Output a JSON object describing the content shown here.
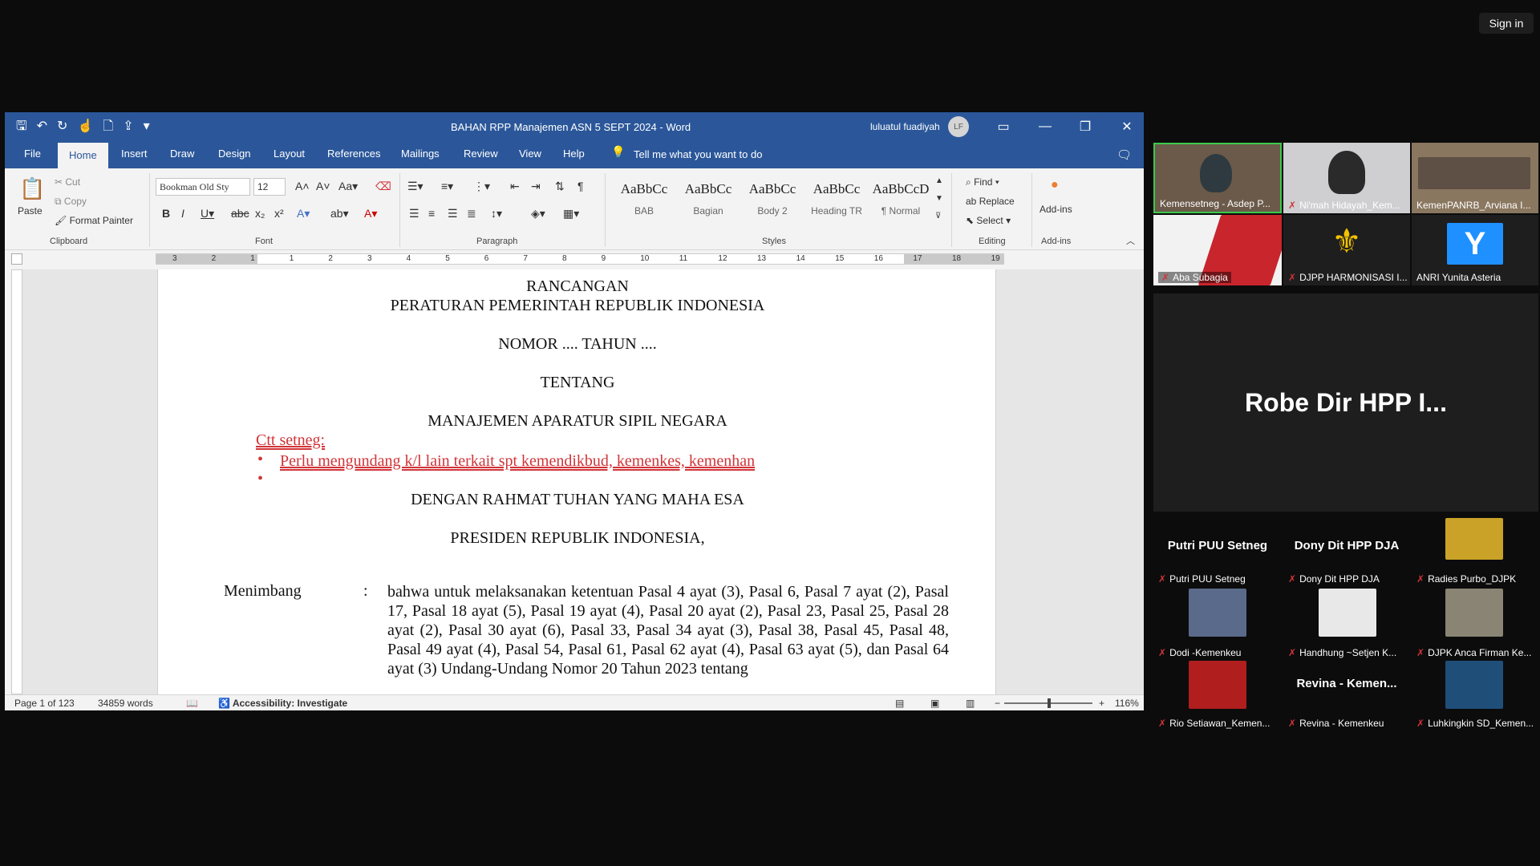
{
  "sign_in": "Sign in",
  "word": {
    "doc_title": "BAHAN RPP Manajemen ASN  5 SEPT 2024  -  Word",
    "user_name": "luluatul fuadiyah",
    "user_initials": "LF",
    "tabs": [
      "File",
      "Home",
      "Insert",
      "Draw",
      "Design",
      "Layout",
      "References",
      "Mailings",
      "Review",
      "View",
      "Help"
    ],
    "tell_me": "Tell me what you want to do",
    "clipboard": {
      "paste": "Paste",
      "cut": "Cut",
      "copy": "Copy",
      "format_painter": "Format Painter",
      "label": "Clipboard"
    },
    "font": {
      "name": "Bookman Old Sty",
      "size": "12",
      "label": "Font"
    },
    "paragraph_label": "Paragraph",
    "styles": [
      {
        "sample": "AaBbCc",
        "name": "BAB"
      },
      {
        "sample": "AaBbCc",
        "name": "Bagian"
      },
      {
        "sample": "AaBbCc",
        "name": "Body 2"
      },
      {
        "sample": "AaBbCc",
        "name": "Heading TR"
      },
      {
        "sample": "AaBbCcD",
        "name": "¶ Normal"
      }
    ],
    "styles_label": "Styles",
    "editing": {
      "find": "Find",
      "replace": "Replace",
      "select": "Select",
      "label": "Editing"
    },
    "addins": {
      "button": "Add-ins",
      "label": "Add-ins"
    },
    "document": {
      "line1": "RANCANGAN",
      "line2": "PERATURAN PEMERINTAH REPUBLIK INDONESIA",
      "line3": "NOMOR .... TAHUN ....",
      "line4": "TENTANG",
      "line5": "MANAJEMEN APARATUR SIPIL NEGARA",
      "note_title": "Ctt setneg:",
      "note_bullet": "Perlu mengundang k/l lain terkait spt kemendikbud, kemenkes, kemenhan",
      "line6": "DENGAN RAHMAT TUHAN YANG MAHA ESA",
      "line7": "PRESIDEN REPUBLIK INDONESIA,",
      "menimbang": "Menimbang",
      "colon": ":",
      "para": "bahwa untuk  melaksanakan ketentuan Pasal 4 ayat (3), Pasal 6, Pasal 7 ayat (2), Pasal 17, Pasal 18 ayat (5), Pasal 19 ayat (4), Pasal 20 ayat (2), Pasal 23, Pasal 25, Pasal 28 ayat (2), Pasal 30 ayat (6), Pasal 33, Pasal 34 ayat (3), Pasal 38, Pasal 45, Pasal 48, Pasal 49 ayat (4), Pasal 54, Pasal 61, Pasal 62 ayat (4), Pasal 63 ayat (5), dan Pasal 64 ayat (3) Undang-Undang Nomor 20 Tahun 2023 tentang"
    },
    "status": {
      "page": "Page 1 of 123",
      "words": "34859 words",
      "accessibility": "Accessibility: Investigate",
      "zoom": "116%"
    },
    "ruler_numbers": [
      "3",
      "2",
      "1",
      "1",
      "2",
      "3",
      "4",
      "5",
      "6",
      "7",
      "8",
      "9",
      "10",
      "11",
      "12",
      "13",
      "14",
      "15",
      "16",
      "17",
      "18",
      "19"
    ]
  },
  "meeting": {
    "top_tiles": [
      "Kemensetneg - Asdep P...",
      "Ni'mah Hidayah_Kem...",
      "KemenPANRB_Arviana I...",
      "Aba Subagia",
      "DJPP HARMONISASI I...",
      "ANRI Yunita Asteria"
    ],
    "anri_letter": "Y",
    "speaker": "Robe Dir HPP I...",
    "bottom_tiles": [
      {
        "top": "Putri PUU Setneg",
        "label": "Putri PUU Setneg"
      },
      {
        "top": "Dony Dit HPP DJA",
        "label": "Dony Dit HPP DJA"
      },
      {
        "top": "",
        "label": "Radies Purbo_DJPK"
      },
      {
        "top": "",
        "label": "Dodi -Kemenkeu"
      },
      {
        "top": "",
        "label": "Handhung ~Setjen K..."
      },
      {
        "top": "",
        "label": "DJPK Anca Firman Ke..."
      },
      {
        "top": "",
        "label": "Rio Setiawan_Kemen..."
      },
      {
        "top": "Revina - Kemen...",
        "label": "Revina - Kemenkeu"
      },
      {
        "top": "",
        "label": "Luhkingkin SD_Kemen..."
      }
    ]
  }
}
